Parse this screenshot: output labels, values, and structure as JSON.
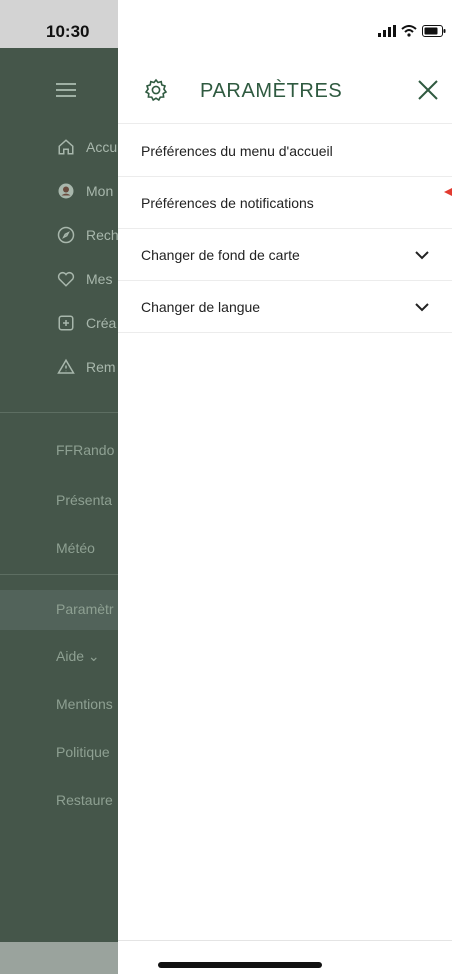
{
  "status": {
    "time": "10:30"
  },
  "panel": {
    "title": "PARAMÈTRES",
    "items": [
      {
        "label": "Préférences du menu d'accueil",
        "has_chevron": false
      },
      {
        "label": "Préférences de notifications",
        "has_chevron": false
      },
      {
        "label": "Changer de fond de carte",
        "has_chevron": true
      },
      {
        "label": "Changer de langue",
        "has_chevron": true
      }
    ]
  },
  "background_drawer": {
    "rows": [
      {
        "label": "Accu",
        "icon": "home-icon"
      },
      {
        "label": "Mon",
        "icon": "avatar-icon"
      },
      {
        "label": "Rech",
        "icon": "compass-icon"
      },
      {
        "label": "Mes",
        "icon": "heart-icon"
      },
      {
        "label": "Créa",
        "icon": "plus-square-icon"
      },
      {
        "label": "Rem",
        "icon": "warning-icon"
      }
    ],
    "links_group1": [
      "FFRando",
      "Présenta",
      "Météo"
    ],
    "links_group2": [
      "Paramètr",
      "Aide ⌄",
      "Mentions",
      "Politique",
      "Restaure"
    ]
  },
  "colors": {
    "accent": "#2f5a40",
    "drawer_bg": "#45564a",
    "text": "#222222"
  }
}
